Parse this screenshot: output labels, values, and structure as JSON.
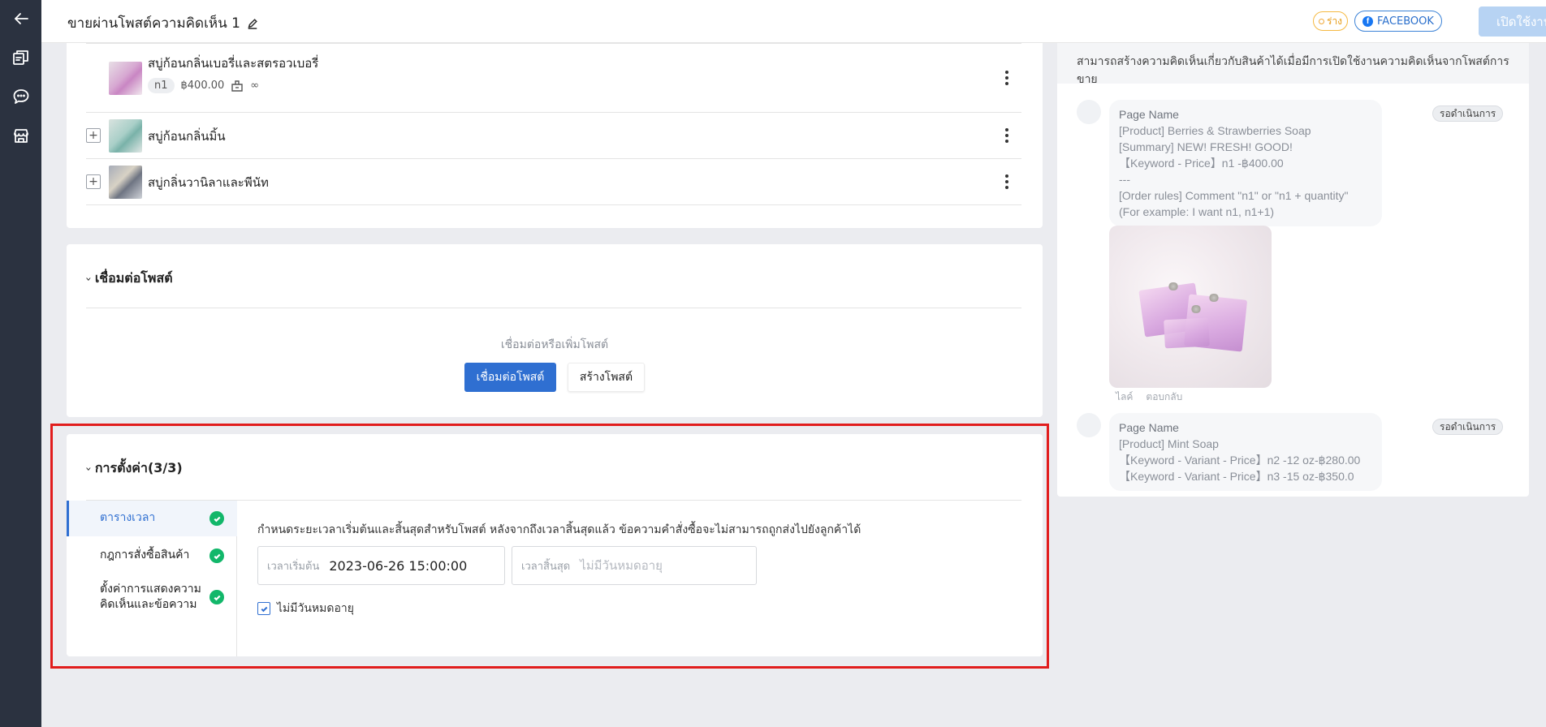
{
  "header": {
    "title": "ขายผ่านโพสต์ความคิดเห็น 1",
    "status": "ร่าง",
    "platform": "FACEBOOK",
    "enable_button": "เปิดใช้งาน"
  },
  "products": [
    {
      "name": "สบู่ก้อนกลิ่นเบอรี่และสตรอวเบอรี่",
      "keyword": "n1",
      "price": "฿400.00",
      "stock": "∞"
    },
    {
      "name": "สบู่ก้อนกลิ่นมิ้น"
    },
    {
      "name": "สบู่กลิ่นวานิลาและพีนัท"
    }
  ],
  "connect": {
    "title": "เชื่อมต่อโพสต์",
    "hint": "เชื่อมต่อหรือเพิ่มโพสต์",
    "connect_button": "เชื่อมต่อโพสต์",
    "create_button": "สร้างโพสต์"
  },
  "settings": {
    "title": "การตั้งค่า(3/3)",
    "nav": [
      {
        "label": "ตารางเวลา",
        "done": true
      },
      {
        "label": "กฎการสั่งซื้อสินค้า",
        "done": true
      },
      {
        "label": "ตั้งค่าการแสดงความคิดเห็นและข้อความ",
        "done": true
      }
    ],
    "description": "กำหนดระยะเวลาเริ่มต้นและสิ้นสุดสำหรับโพสต์ หลังจากถึงเวลาสิ้นสุดแล้ว ข้อความคำสั่งซื้อจะไม่สามารถถูกส่งไปยังลูกค้าได้",
    "start_label": "เวลาเริ่มต้น",
    "start_value": "2023-06-26 15:00:00",
    "end_label": "เวลาสิ้นสุด",
    "end_placeholder": "ไม่มีวันหมดอายุ",
    "no_expiry_label": "ไม่มีวันหมดอายุ",
    "no_expiry_checked": true
  },
  "preview": {
    "notice": "สามารถสร้างความคิดเห็นเกี่ยวกับสินค้าได้เมื่อมีการเปิดใช้งานความคิดเห็นจากโพสต์การขาย",
    "comments": [
      {
        "name": "Page Name",
        "status": "รอดำเนินการ",
        "lines": [
          "[Product] Berries & Strawberries Soap",
          "[Summary] NEW! FRESH! GOOD!",
          "【Keyword - Price】n1 -฿400.00",
          "---",
          "[Order rules] Comment \"n1\" or \"n1 + quantity\"",
          "(For example: I want n1, n1+1)"
        ],
        "actions": [
          "ไลค์",
          "ตอบกลับ"
        ]
      },
      {
        "name": "Page Name",
        "status": "รอดำเนินการ",
        "lines": [
          "[Product] Mint Soap",
          "【Keyword - Variant - Price】n2 -12 oz-฿280.00",
          "【Keyword - Variant - Price】n3 -15 oz-฿350.0"
        ]
      }
    ]
  },
  "icons": {
    "back": "arrow-left-icon",
    "sidebar": [
      "post-icon",
      "chat-icon",
      "shop-icon"
    ],
    "edit": "pencil-icon",
    "check": "check-circle-icon"
  },
  "colors": {
    "sidebar_bg": "#2b3240",
    "primary": "#2f6fd1",
    "success": "#12b76a",
    "highlight": "#e11d1d"
  }
}
